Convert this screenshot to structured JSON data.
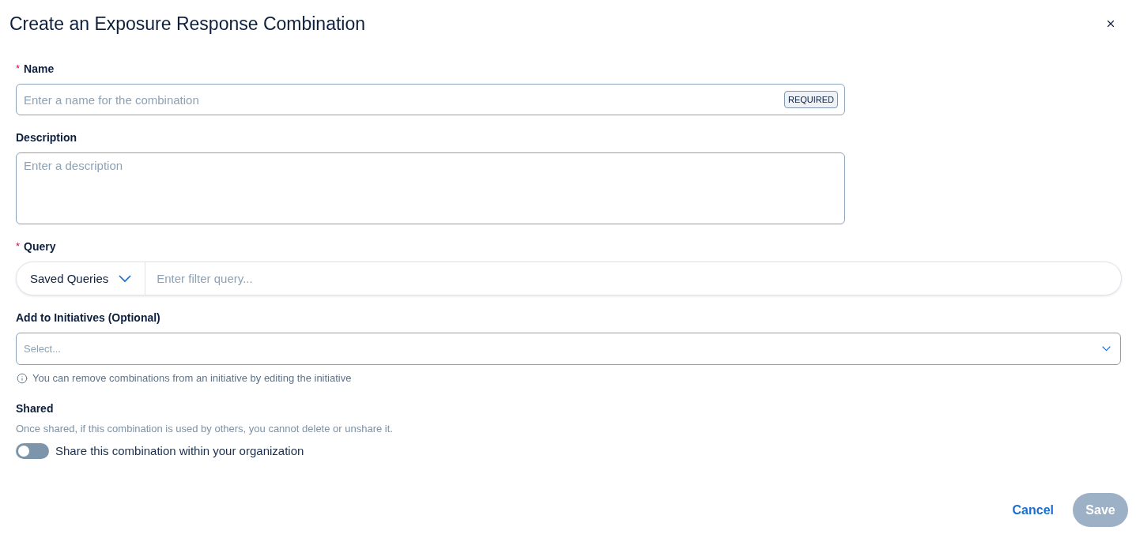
{
  "title": "Create an Exposure Response Combination",
  "fields": [
    {
      "kind": "text",
      "label": "Name",
      "required_mark": "*",
      "placeholder": "Enter a name for the combination",
      "badge": "REQUIRED"
    },
    {
      "kind": "textarea",
      "label": "Description",
      "placeholder": "Enter a description"
    },
    {
      "kind": "query",
      "label": "Query",
      "required_mark": "*",
      "dropdown": "Saved Queries",
      "placeholder": "Enter filter query..."
    },
    {
      "kind": "select",
      "label": "Add to Initiatives (Optional)",
      "placeholder": "Select...",
      "hint": "You can remove combinations from an initiative by editing the initiative"
    }
  ],
  "shared": {
    "label": "Shared",
    "description": "Once shared, if this combination is used by others, you cannot delete or unshare it.",
    "toggle": {
      "label": "Share this combination within your organization",
      "on": false
    }
  },
  "buttons": [
    {
      "kind": "link",
      "label": "Cancel",
      "disabled": false
    },
    {
      "kind": "primary",
      "label": "Save",
      "disabled": true
    }
  ]
}
